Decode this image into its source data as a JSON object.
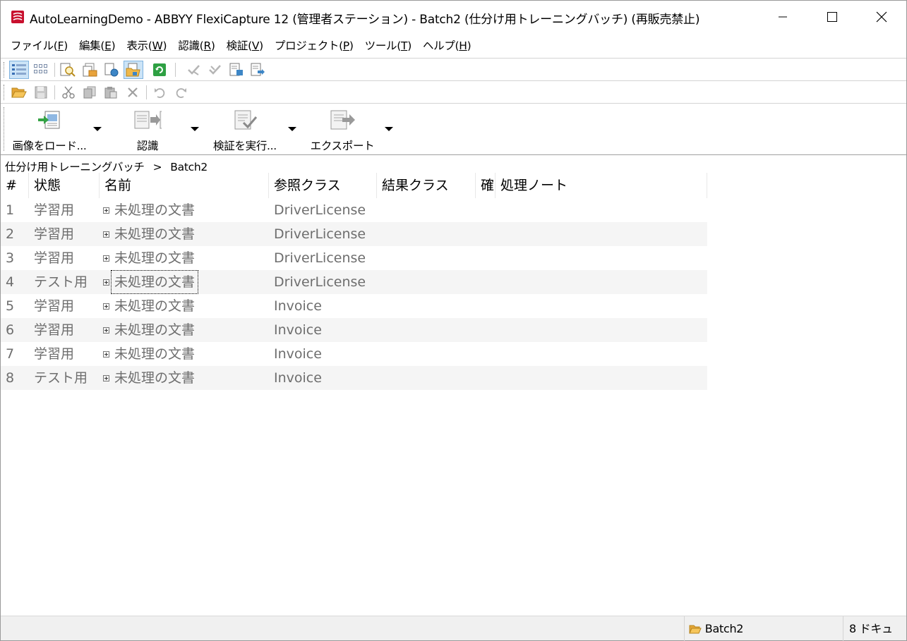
{
  "window": {
    "title": "AutoLearningDemo - ABBYY FlexiCapture 12 (管理者ステーション) - Batch2 (仕分け用トレーニングバッチ) (再販売禁止)"
  },
  "menu": [
    {
      "label": "ファイル(",
      "key": "F",
      "end": ")"
    },
    {
      "label": "編集(",
      "key": "E",
      "end": ")"
    },
    {
      "label": "表示(",
      "key": "W",
      "end": ")"
    },
    {
      "label": "認識(",
      "key": "R",
      "end": ")"
    },
    {
      "label": "検証(",
      "key": "V",
      "end": ")"
    },
    {
      "label": "プロジェクト(",
      "key": "P",
      "end": ")"
    },
    {
      "label": "ツール(",
      "key": "T",
      "end": ")"
    },
    {
      "label": "ヘルプ(",
      "key": "H",
      "end": ")"
    }
  ],
  "big_buttons": {
    "load": "画像をロード...",
    "recognize": "認識",
    "verify": "検証を実行...",
    "export": "エクスポート"
  },
  "breadcrumb": {
    "root": "仕分け用トレーニングバッチ",
    "separator": ">",
    "current": "Batch2"
  },
  "table": {
    "columns": {
      "num": "#",
      "status": "状態",
      "name": "名前",
      "ref_class": "参照クラス",
      "result_class": "結果クラス",
      "confirm": "確",
      "note": "処理ノート"
    },
    "rows": [
      {
        "num": "1",
        "status": "学習用",
        "name": "未処理の文書",
        "ref_class": "DriverLicense",
        "result_class": "",
        "confirm": "",
        "note": ""
      },
      {
        "num": "2",
        "status": "学習用",
        "name": "未処理の文書",
        "ref_class": "DriverLicense",
        "result_class": "",
        "confirm": "",
        "note": ""
      },
      {
        "num": "3",
        "status": "学習用",
        "name": "未処理の文書",
        "ref_class": "DriverLicense",
        "result_class": "",
        "confirm": "",
        "note": ""
      },
      {
        "num": "4",
        "status": "テスト用",
        "name": "未処理の文書",
        "ref_class": "DriverLicense",
        "result_class": "",
        "confirm": "",
        "note": ""
      },
      {
        "num": "5",
        "status": "学習用",
        "name": "未処理の文書",
        "ref_class": "Invoice",
        "result_class": "",
        "confirm": "",
        "note": ""
      },
      {
        "num": "6",
        "status": "学習用",
        "name": "未処理の文書",
        "ref_class": "Invoice",
        "result_class": "",
        "confirm": "",
        "note": ""
      },
      {
        "num": "7",
        "status": "学習用",
        "name": "未処理の文書",
        "ref_class": "Invoice",
        "result_class": "",
        "confirm": "",
        "note": ""
      },
      {
        "num": "8",
        "status": "テスト用",
        "name": "未処理の文書",
        "ref_class": "Invoice",
        "result_class": "",
        "confirm": "",
        "note": ""
      }
    ]
  },
  "statusbar": {
    "batch": "Batch2",
    "docs": "8 ドキュ"
  },
  "colors": {
    "accent_red": "#c8102e",
    "pressed_bg": "#cce4f7",
    "row_alt": "#f5f5f5",
    "cell_text": "#6e6e6e"
  }
}
